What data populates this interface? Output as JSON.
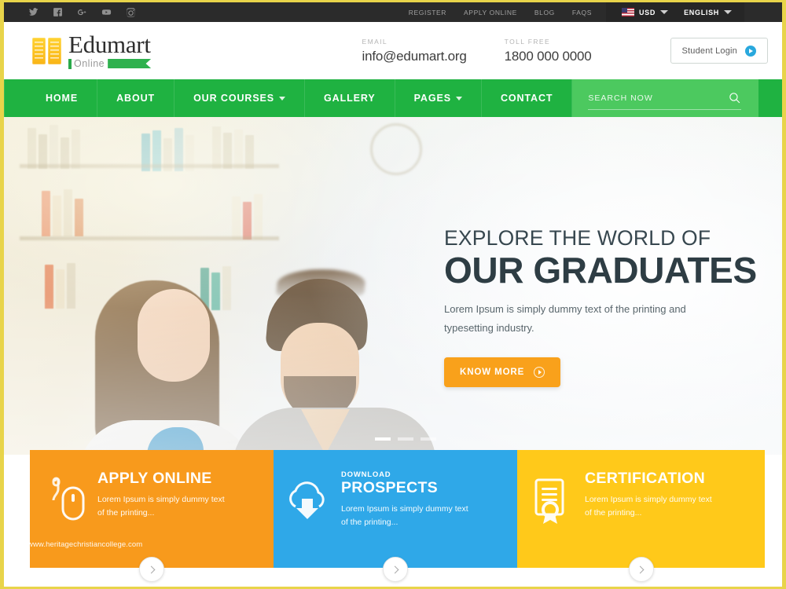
{
  "topbar": {
    "social": [
      {
        "name": "twitter-icon",
        "label": "Twitter"
      },
      {
        "name": "facebook-icon",
        "label": "Facebook"
      },
      {
        "name": "google-plus-icon",
        "label": "Google Plus"
      },
      {
        "name": "youtube-icon",
        "label": "YouTube"
      },
      {
        "name": "instagram-icon",
        "label": "Instagram"
      }
    ],
    "links": [
      "REGISTER",
      "APPLY ONLINE",
      "BLOG",
      "FAQS"
    ],
    "currency": "USD",
    "language": "ENGLISH"
  },
  "header": {
    "logo_name": "Edumart",
    "logo_sub": "Online",
    "email_label": "EMAIL",
    "email_value": "info@edumart.org",
    "phone_label": "TOLL FREE",
    "phone_value": "1800 000 0000",
    "login_label": "Student Login"
  },
  "nav": {
    "items": [
      {
        "label": "HOME",
        "has_dropdown": false
      },
      {
        "label": "ABOUT",
        "has_dropdown": false
      },
      {
        "label": "OUR COURSES",
        "has_dropdown": true
      },
      {
        "label": "GALLERY",
        "has_dropdown": false
      },
      {
        "label": "PAGES",
        "has_dropdown": true
      },
      {
        "label": "CONTACT",
        "has_dropdown": false
      }
    ],
    "search_placeholder": "SEARCH NOW"
  },
  "hero": {
    "subtitle": "EXPLORE THE WORLD OF",
    "title": "OUR GRADUATES",
    "description": "Lorem Ipsum is simply dummy text of the printing and typesetting industry.",
    "cta_label": "KNOW MORE",
    "slide_count": 3,
    "active_slide": 1
  },
  "cards": [
    {
      "kicker": "",
      "title": "APPLY ONLINE",
      "desc": "Lorem Ipsum is simply dummy text of the printing...",
      "icon": "mouse-icon",
      "color": "#F89A1C"
    },
    {
      "kicker": "DOWNLOAD",
      "title": "PROSPECTS",
      "desc": "Lorem Ipsum is simply dummy text of the printing...",
      "icon": "cloud-download-icon",
      "color": "#2FA8E8"
    },
    {
      "kicker": "",
      "title": "CERTIFICATION",
      "desc": "Lorem Ipsum is simply dummy text of the printing...",
      "icon": "certificate-icon",
      "color": "#FFC91A"
    }
  ],
  "watermark": "www.heritagechristiancollege.com",
  "colors": {
    "nav_green": "#1FB241",
    "search_green": "#4CC95F",
    "orange": "#F89A1C",
    "blue": "#2FA8E8",
    "yellow": "#FFC91A",
    "cta_orange": "#F9A11B",
    "topbar_dark": "#2B2B2B",
    "frame_yellow": "#E8D44A"
  }
}
